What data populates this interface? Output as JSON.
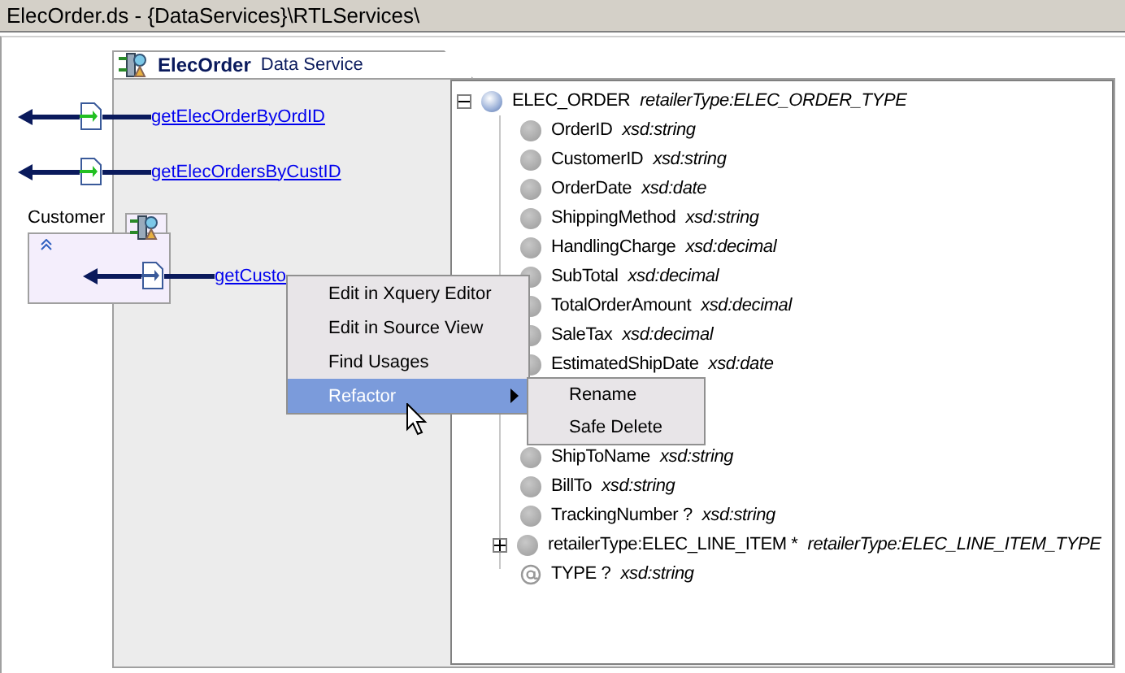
{
  "window": {
    "title": "ElecOrder.ds - {DataServices}\\RTLServices\\"
  },
  "operations": [
    {
      "label": "getElecOrderByOrdID"
    },
    {
      "label": "getElecOrdersByCustID"
    }
  ],
  "customer_node": {
    "title": "Customer",
    "operation": "getCusto"
  },
  "data_service": {
    "name": "ElecOrder",
    "kind_label": "Data Service"
  },
  "tree": {
    "name": "ELEC_ORDER",
    "type": "retailerType:ELEC_ORDER_TYPE",
    "expanded": true,
    "children": [
      {
        "kind": "element",
        "name": "OrderID",
        "type": "xsd:string"
      },
      {
        "kind": "element",
        "name": "CustomerID",
        "type": "xsd:string"
      },
      {
        "kind": "element",
        "name": "OrderDate",
        "type": "xsd:date"
      },
      {
        "kind": "element",
        "name": "ShippingMethod",
        "type": "xsd:string"
      },
      {
        "kind": "element",
        "name": "HandlingCharge",
        "type": "xsd:decimal"
      },
      {
        "kind": "element",
        "name": "SubTotal",
        "type": "xsd:decimal"
      },
      {
        "kind": "element",
        "name": "TotalOrderAmount",
        "type": "xsd:decimal"
      },
      {
        "kind": "element",
        "name": "SaleTax",
        "type": "xsd:decimal"
      },
      {
        "kind": "element",
        "name": "EstimatedShipDate",
        "type": "xsd:date"
      },
      {
        "kind": "element",
        "name": "ShipToName",
        "type": "xsd:string"
      },
      {
        "kind": "element",
        "name": "BillTo",
        "type": "xsd:string"
      },
      {
        "kind": "element",
        "name": "TrackingNumber ?",
        "type": "xsd:string"
      },
      {
        "kind": "element",
        "name": "retailerType:ELEC_LINE_ITEM *",
        "type": "retailerType:ELEC_LINE_ITEM_TYPE",
        "expanded": false
      },
      {
        "kind": "attribute",
        "name": "TYPE ?",
        "type": "xsd:string"
      }
    ]
  },
  "context_menu": {
    "items": [
      {
        "label": "Edit in Xquery Editor",
        "selected": false,
        "submenu": false
      },
      {
        "label": "Edit in Source View",
        "selected": false,
        "submenu": false
      },
      {
        "label": "Find Usages",
        "selected": false,
        "submenu": false
      },
      {
        "label": "Refactor",
        "selected": true,
        "submenu": true
      }
    ]
  },
  "submenu": {
    "items": [
      {
        "label": "Rename",
        "selected": false
      },
      {
        "label": "Safe Delete",
        "selected": false
      }
    ]
  }
}
